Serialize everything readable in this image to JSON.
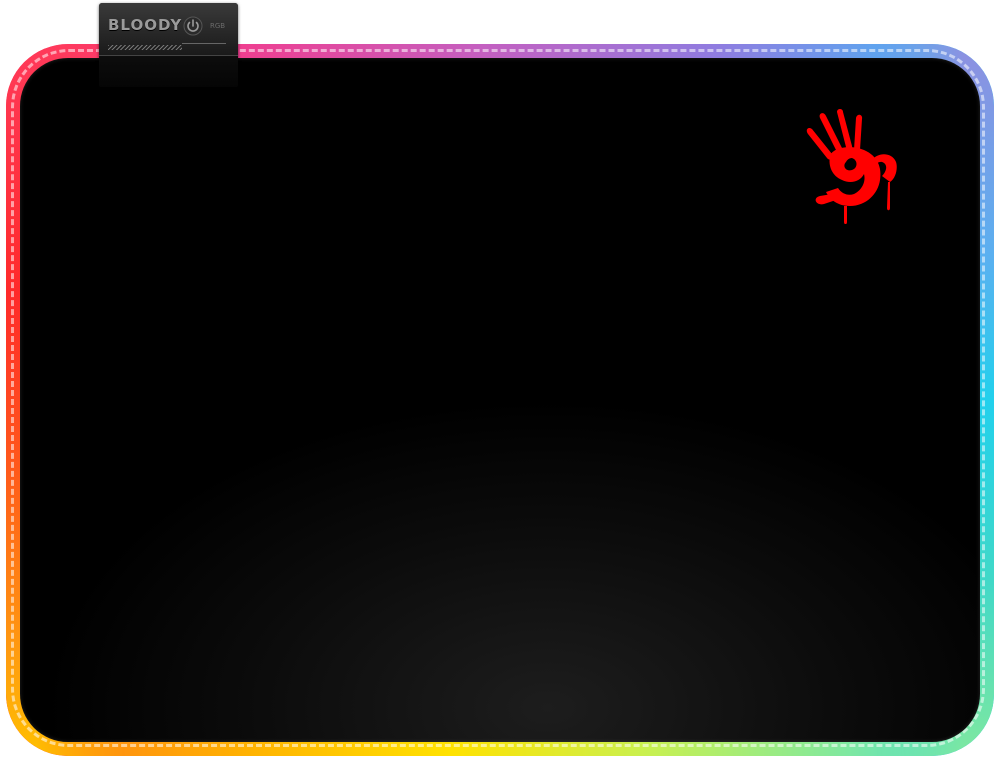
{
  "product": {
    "type": "rgb-mouse-pad",
    "controller": {
      "brand_label": "BLOODY",
      "mode_label": "RGB",
      "power_icon": "power-icon"
    },
    "logo_icon": "bloody-hand-logo-icon",
    "colors": {
      "surface": "#000000",
      "logo_red": "#ff0000",
      "edge_top": [
        "#ff3a5a",
        "#c45fc0",
        "#5aa8f0"
      ],
      "edge_left": [
        "#ff3a5a",
        "#ff2a2a",
        "#ff9a10"
      ],
      "edge_right": [
        "#8f8fe0",
        "#22d0ec",
        "#7fe8a0"
      ],
      "edge_bottom": [
        "#ffb300",
        "#ffe200",
        "#7fe8a0"
      ]
    }
  }
}
